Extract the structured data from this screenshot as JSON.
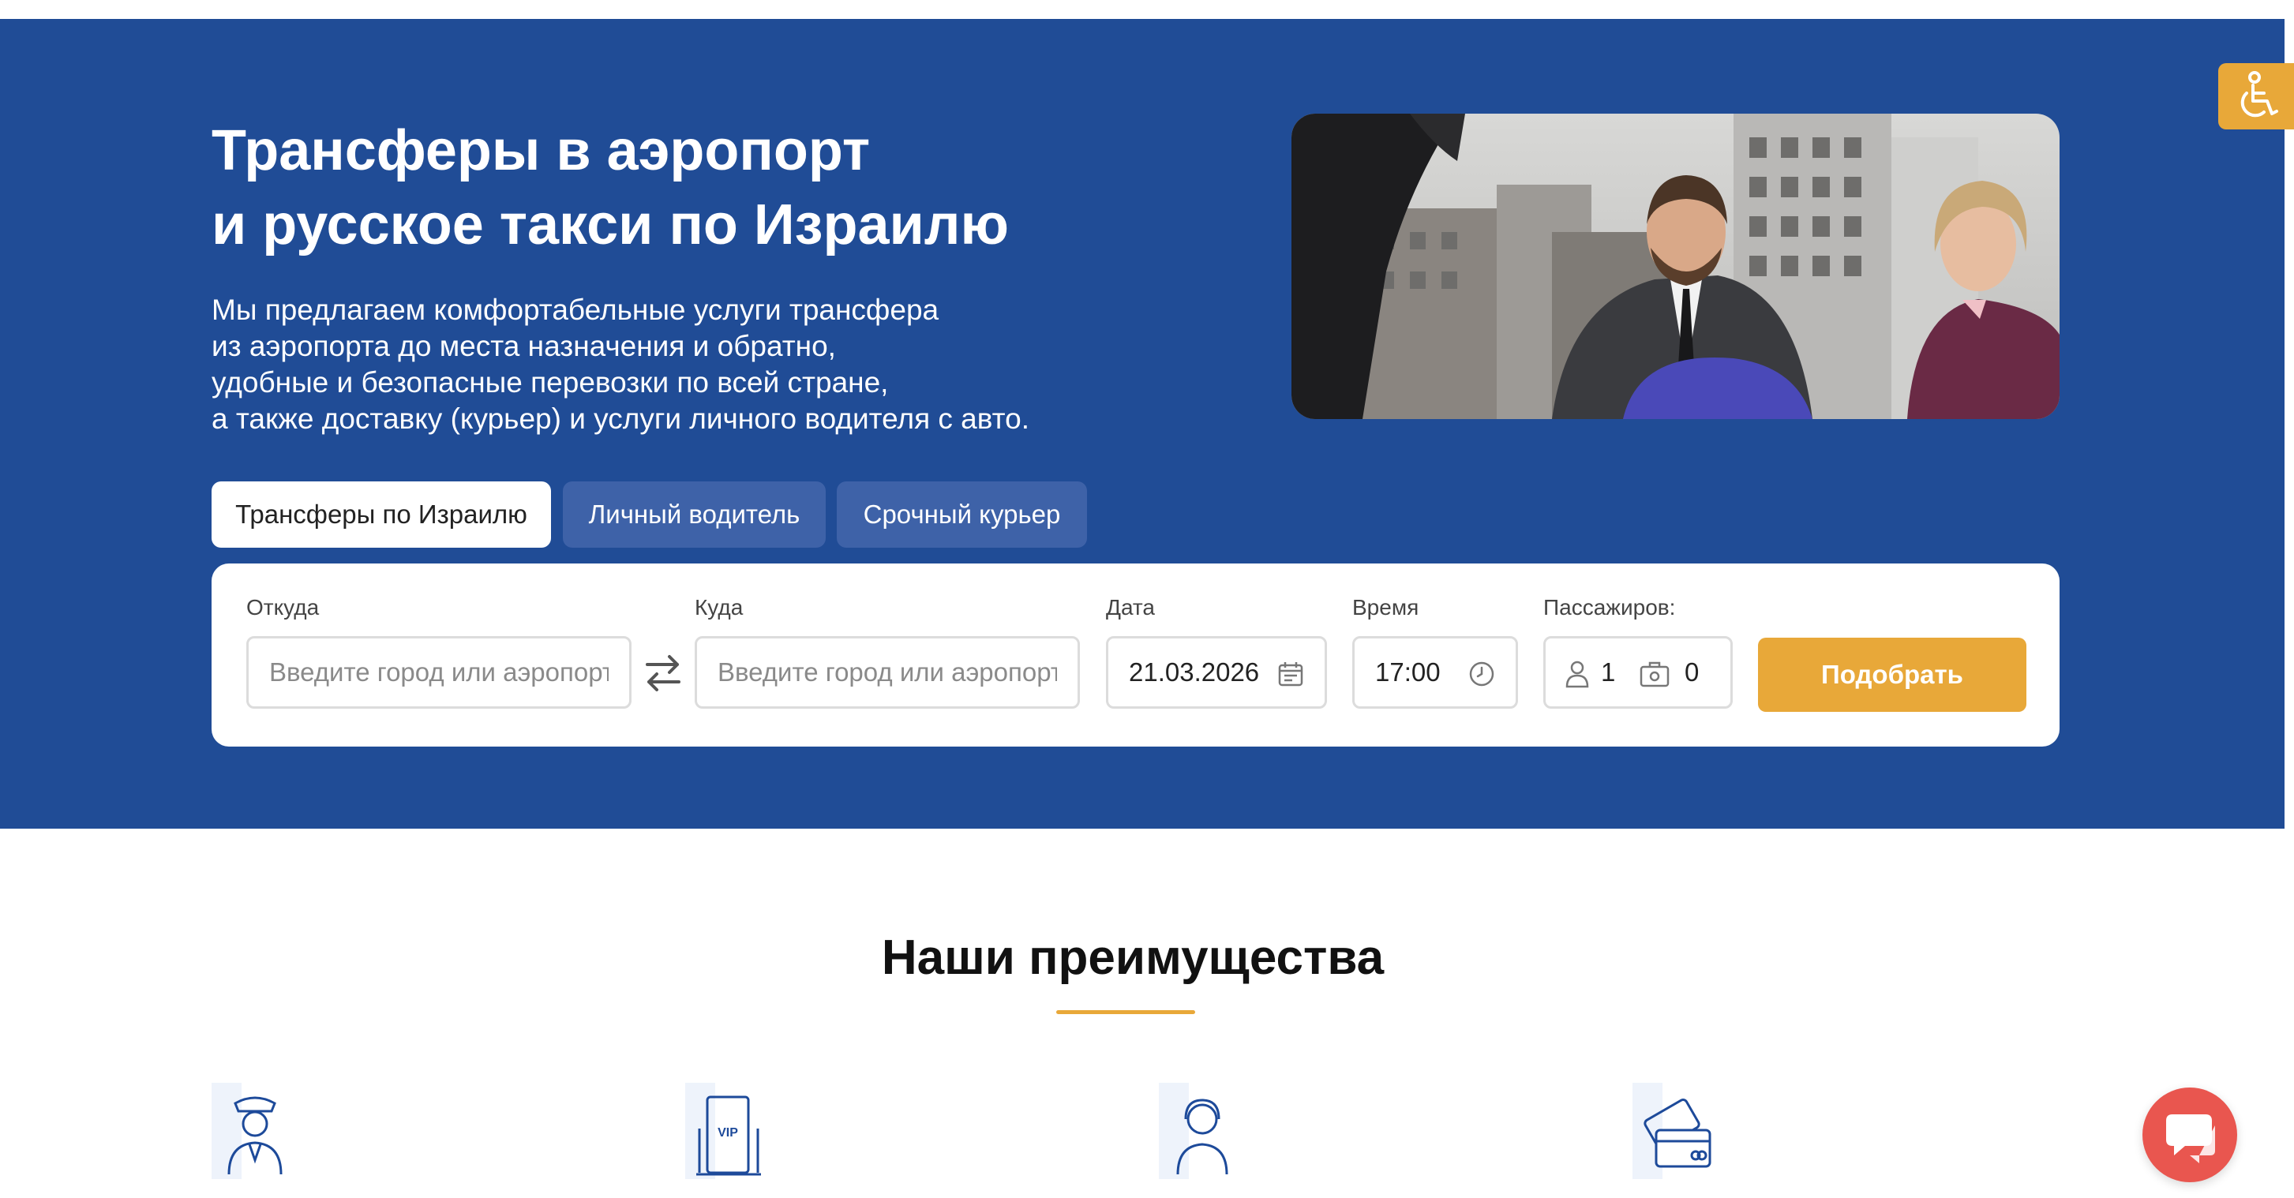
{
  "hero": {
    "title_line1": "Трансферы в аэропорт",
    "title_line2": "и русское такси по Израилю",
    "desc_line1": "Мы предлагаем комфортабельные услуги трансфера",
    "desc_line2": "из аэропорта до места назначения и обратно,",
    "desc_line3": "удобные и безопасные перевозки по всей стране,",
    "desc_line4": "а также доставку (курьер) и услуги личного водителя с авто."
  },
  "tabs": [
    {
      "label": "Трансферы по Израилю",
      "active": true
    },
    {
      "label": "Личный водитель",
      "active": false
    },
    {
      "label": "Срочный курьер",
      "active": false
    }
  ],
  "form": {
    "from_label": "Откуда",
    "from_placeholder": "Введите город или аэропорт",
    "to_label": "Куда",
    "to_placeholder": "Введите город или аэропорт",
    "date_label": "Дата",
    "date_value": "21.03.2026",
    "time_label": "Время",
    "time_value": "17:00",
    "passengers_label": "Пассажиров:",
    "passengers_value": "1",
    "luggage_value": "0",
    "submit_label": "Подобрать"
  },
  "features": {
    "title": "Наши преимущества",
    "icons": [
      "driver-icon",
      "vip-icon",
      "support-operator-icon",
      "payment-card-icon"
    ]
  },
  "colors": {
    "hero_bg": "#204c96",
    "tab_inactive": "#3e62a8",
    "accent": "#e8a839",
    "chat": "#e9564f"
  }
}
